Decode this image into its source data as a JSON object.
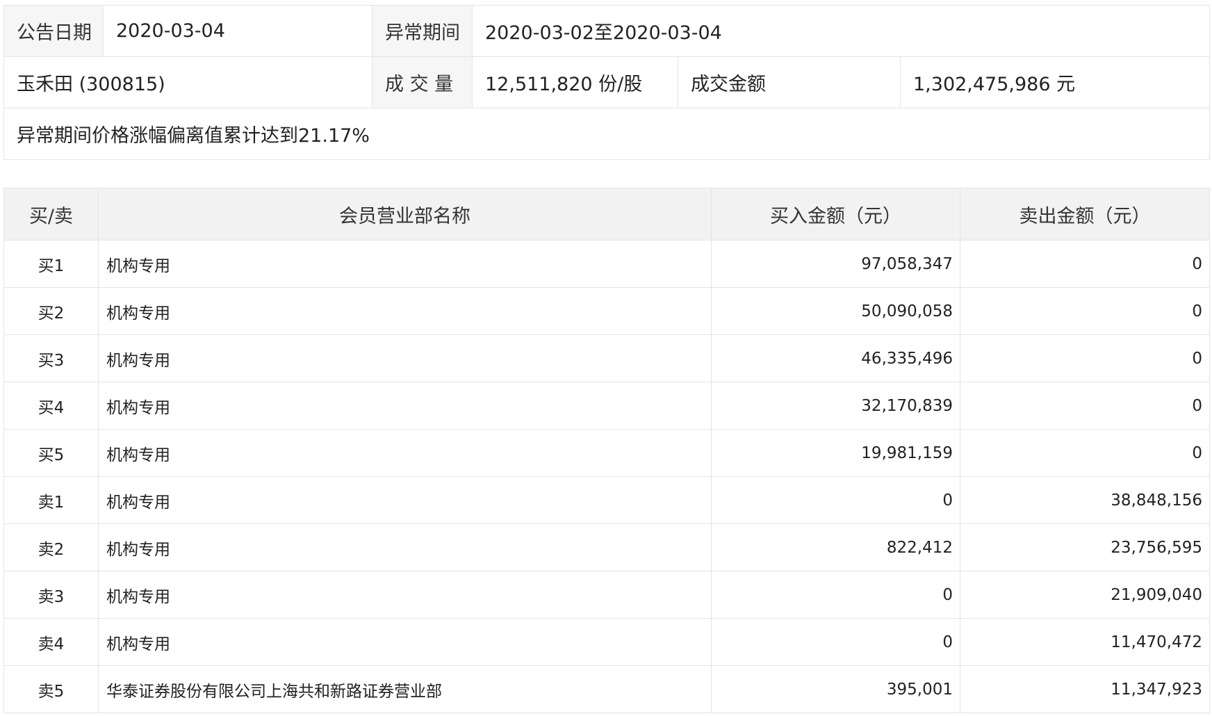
{
  "summary": {
    "announce_date_label": "公告日期",
    "announce_date": "2020-03-04",
    "abnormal_period_label": "异常期间",
    "abnormal_period": "2020-03-02至2020-03-04",
    "stock": "玉禾田 (300815)",
    "volume_label": "成 交 量",
    "volume": "12,511,820 份/股",
    "amount_label": "成交金额",
    "amount": "1,302,475,986 元",
    "note": "异常期间价格涨幅偏离值累计达到21.17%"
  },
  "detail": {
    "headers": [
      "买/卖",
      "会员营业部名称",
      "买入金额（元）",
      "卖出金额（元）"
    ],
    "rows": [
      {
        "side": "买1",
        "name": "机构专用",
        "buy": "97,058,347",
        "sell": "0"
      },
      {
        "side": "买2",
        "name": "机构专用",
        "buy": "50,090,058",
        "sell": "0"
      },
      {
        "side": "买3",
        "name": "机构专用",
        "buy": "46,335,496",
        "sell": "0"
      },
      {
        "side": "买4",
        "name": "机构专用",
        "buy": "32,170,839",
        "sell": "0"
      },
      {
        "side": "买5",
        "name": "机构专用",
        "buy": "19,981,159",
        "sell": "0"
      },
      {
        "side": "卖1",
        "name": "机构专用",
        "buy": "0",
        "sell": "38,848,156"
      },
      {
        "side": "卖2",
        "name": "机构专用",
        "buy": "822,412",
        "sell": "23,756,595"
      },
      {
        "side": "卖3",
        "name": "机构专用",
        "buy": "0",
        "sell": "21,909,040"
      },
      {
        "side": "卖4",
        "name": "机构专用",
        "buy": "0",
        "sell": "11,470,472"
      },
      {
        "side": "卖5",
        "name": "华泰证券股份有限公司上海共和新路证券营业部",
        "buy": "395,001",
        "sell": "11,347,923"
      }
    ]
  }
}
